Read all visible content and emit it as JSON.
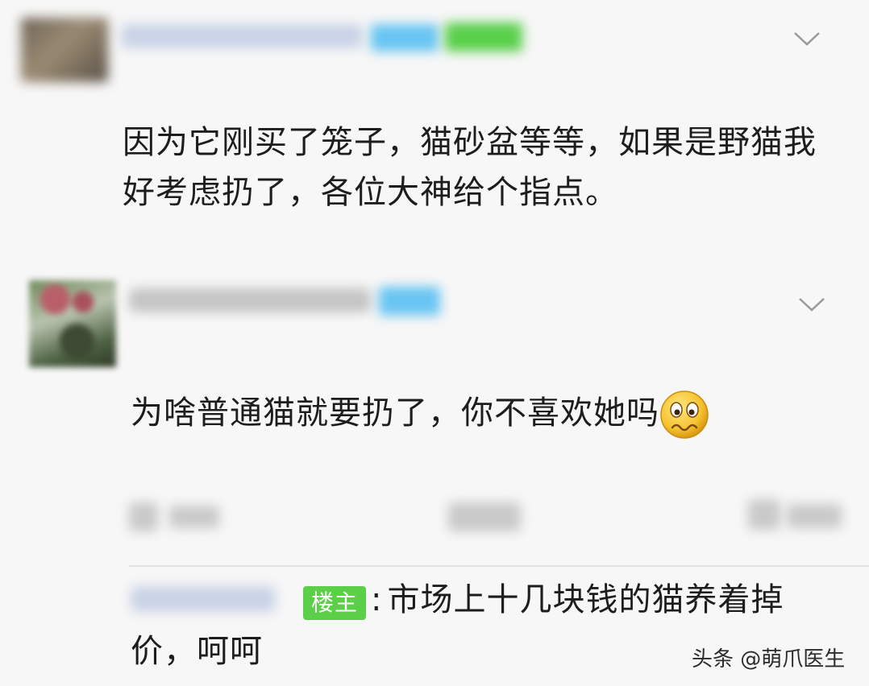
{
  "comments": [
    {
      "avatar_icon": "avatar-image",
      "text_line1": "因为它刚买了笼子，猫砂盆等等，如果是野猫我",
      "text_line2": "好考虑扔了，各位大神给个指点。"
    },
    {
      "avatar_icon": "avatar-image",
      "text": "为啥普通猫就要扔了，你不喜欢她吗",
      "emoji_icon": "worried-face-emoji",
      "reply": {
        "owner_tag": "楼主",
        "separator": ":",
        "text_line1": "市场上十几块钱的猫养着掉",
        "text_line2": "价，呵呵"
      }
    }
  ],
  "watermark": "头条 @萌爪医生",
  "colors": {
    "background": "#f7f7f7",
    "vip_blue": "#68c4f2",
    "level_green": "#59cf4a",
    "owner_tag_green": "#5ccf48"
  }
}
